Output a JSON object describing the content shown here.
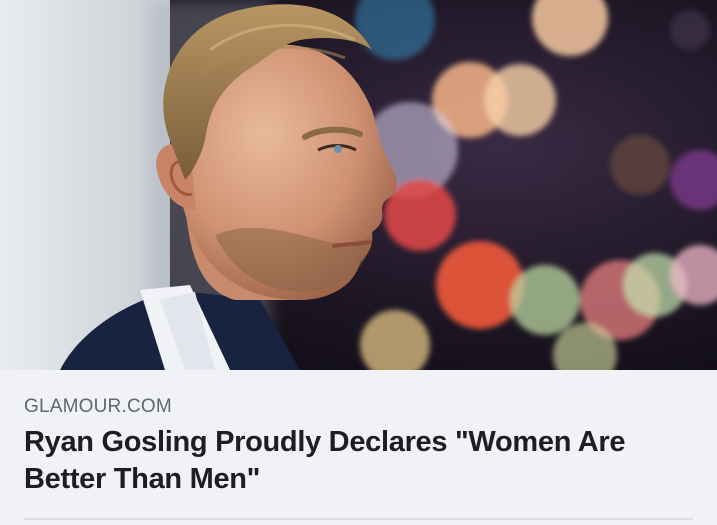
{
  "link_preview": {
    "domain": "GLAMOUR.COM",
    "headline": "Ryan Gosling Proudly Declares \"Women Are Better Than Men\"",
    "image_description_icon": "photo-portrait"
  },
  "colors": {
    "caption_background": "#f0f2f5",
    "domain_text": "#606770",
    "headline_text": "#1c1e21"
  }
}
